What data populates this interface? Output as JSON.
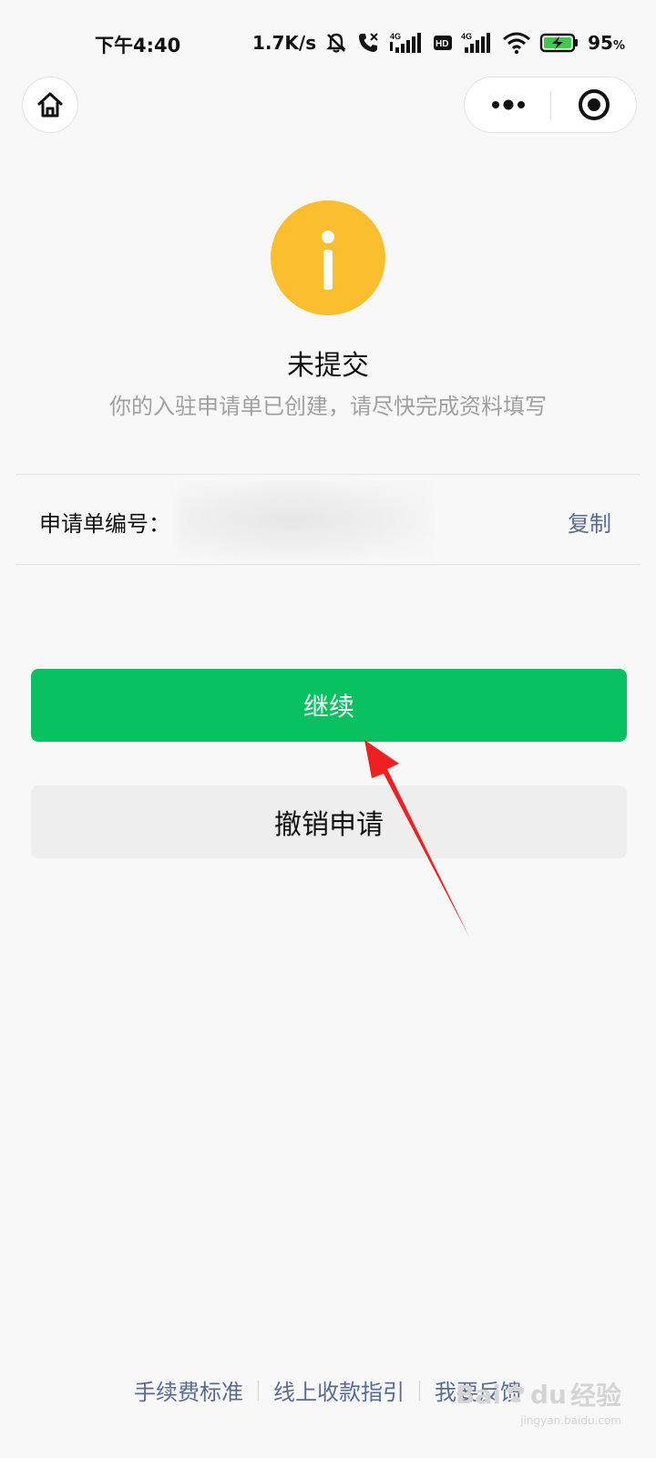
{
  "status_bar": {
    "time": "下午4:40",
    "net_speed": "1.7K/s",
    "battery_percent": "95",
    "battery_unit": "%",
    "icons": [
      "bell-muted-icon",
      "call-icon",
      "signal-4g-icon",
      "hd-icon",
      "signal-4g-icon",
      "wifi-icon",
      "battery-charging-icon"
    ]
  },
  "nav": {
    "home_icon": "home-icon",
    "more_icon": "more-dots-icon",
    "close_icon": "target-close-icon"
  },
  "status": {
    "icon": "info-icon",
    "icon_color": "#fbbe2e",
    "title": "未提交",
    "description": "你的入驻申请单已创建，请尽快完成资料填写"
  },
  "order": {
    "label": "申请单编号：",
    "copy_label": "复制"
  },
  "buttons": {
    "continue_label": "继续",
    "continue_color": "#07c160",
    "cancel_label": "撤销申请"
  },
  "footer": {
    "links": [
      "手续费标准",
      "线上收款指引",
      "我要反馈"
    ],
    "link_color": "#576b95"
  },
  "watermark": {
    "brand_a": "Bai",
    "brand_b": "du",
    "brand_cn": "经验",
    "url": "jingyan.baidu.com"
  }
}
